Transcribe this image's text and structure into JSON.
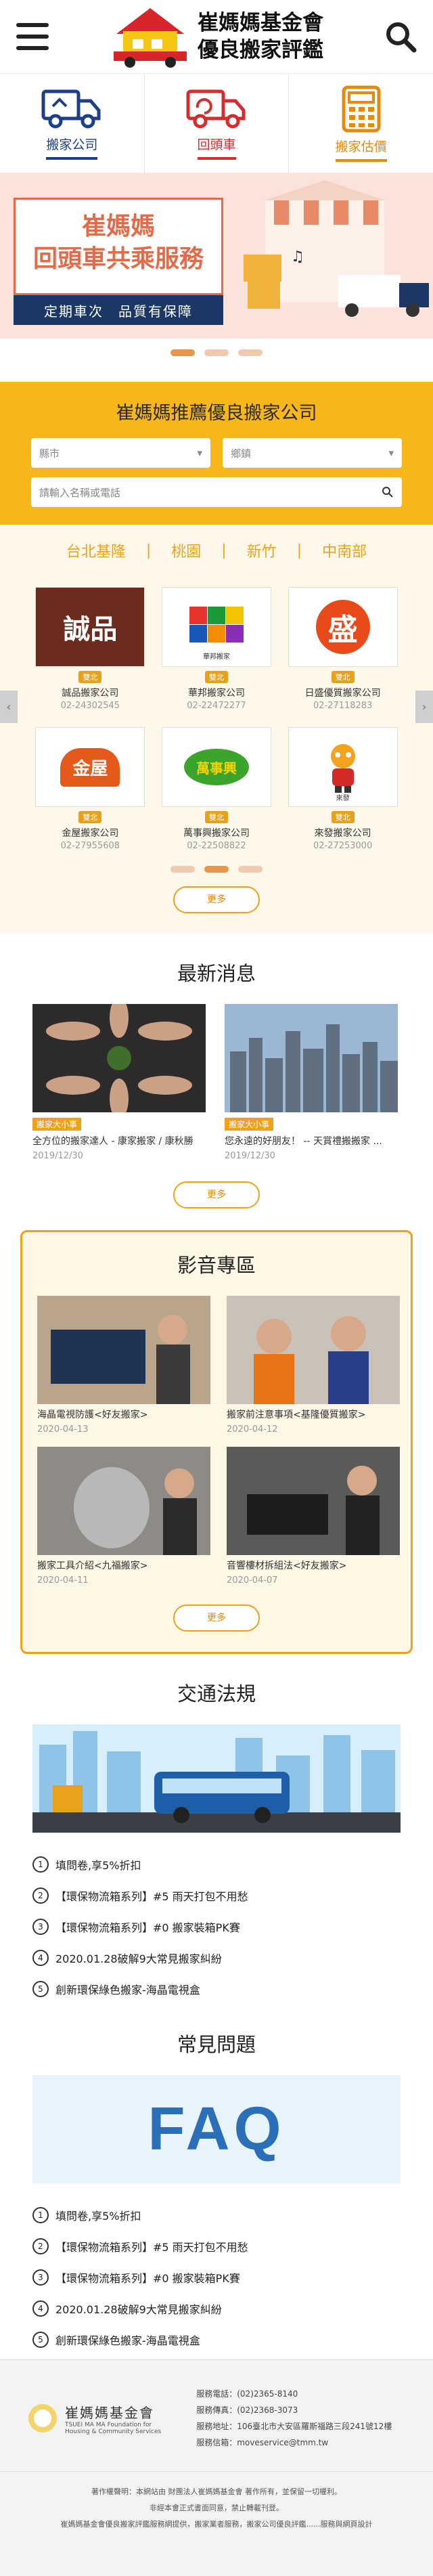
{
  "header": {
    "logo_line1": "崔媽媽基金會",
    "logo_line2": "優良搬家評鑑"
  },
  "services": [
    {
      "label": "搬家公司",
      "icon": "truck-icon"
    },
    {
      "label": "回頭車",
      "icon": "return-truck-icon"
    },
    {
      "label": "搬家估價",
      "icon": "calculator-icon"
    }
  ],
  "banner": {
    "line1": "崔媽媽",
    "line2": "回頭車共乘服務",
    "strip": "定期車次　品質有保障"
  },
  "recommend": {
    "title": "崔媽媽推薦優良搬家公司",
    "city_select": "縣市",
    "district_select": "鄉鎮",
    "search_placeholder": "請輸入名稱或電話",
    "tabs": [
      "台北基隆",
      "桃園",
      "新竹",
      "中南部"
    ],
    "companies": [
      {
        "badge": "雙北",
        "name": "誠品搬家公司",
        "tel": "02-24302545",
        "logo_text": "誠品"
      },
      {
        "badge": "雙北",
        "name": "華邦搬家公司",
        "tel": "02-22472277",
        "logo_text": "華邦搬家"
      },
      {
        "badge": "雙北",
        "name": "日盛優質搬家公司",
        "tel": "02-27118283",
        "logo_text": "盛"
      },
      {
        "badge": "雙北",
        "name": "金屋搬家公司",
        "tel": "02-27955608",
        "logo_text": "金屋"
      },
      {
        "badge": "雙北",
        "name": "萬事興搬家公司",
        "tel": "02-22508822",
        "logo_text": "萬事興"
      },
      {
        "badge": "雙北",
        "name": "來發搬家公司",
        "tel": "02-27253000",
        "logo_text": "來發"
      }
    ],
    "more": "更多"
  },
  "news": {
    "title": "最新消息",
    "items": [
      {
        "tag": "搬家大小事",
        "title": "全方位的搬家達人 - 康家搬家 / 康秋勝",
        "date": "2019/12/30"
      },
      {
        "tag": "搬家大小事",
        "title": "您永遠的好朋友！ -- 天賞禮搬搬家 ...",
        "date": "2019/12/30"
      }
    ],
    "more": "更多"
  },
  "video": {
    "title": "影音專區",
    "items": [
      {
        "title": "海晶電視防護<好友搬家>",
        "date": "2020-04-13"
      },
      {
        "title": "搬家前注意事項<基隆優質搬家>",
        "date": "2020-04-12"
      },
      {
        "title": "搬家工具介紹<九福搬家>",
        "date": "2020-04-11"
      },
      {
        "title": "音響樓材拆組法<好友搬家>",
        "date": "2020-04-07"
      }
    ],
    "more": "更多"
  },
  "traffic": {
    "title": "交通法規",
    "items": [
      "填問卷,享5%折扣",
      "【環保物流箱系列】#5 雨天打包不用愁",
      "【環保物流箱系列】#0 搬家裝箱PK賽",
      "2020.01.28破解9大常見搬家糾紛",
      "創新環保綠色搬家-海晶電視盒"
    ]
  },
  "faq": {
    "title": "常見問題",
    "hero_text": "FAQ",
    "items": [
      "填問卷,享5%折扣",
      "【環保物流箱系列】#5 雨天打包不用愁",
      "【環保物流箱系列】#0 搬家裝箱PK賽",
      "2020.01.28破解9大常見搬家糾紛",
      "創新環保綠色搬家-海晶電視盒"
    ]
  },
  "footer": {
    "org_cn": "崔媽媽基金會",
    "org_en_1": "TSUEI MA MA Foundation for",
    "org_en_2": "Housing & Community Services",
    "phone": "服務電話：(02)2365-8140",
    "fax": "服務傳真：(02)2368-3073",
    "address": "服務地址：106臺北市大安區羅斯福路三段241號12樓",
    "email": "服務信箱：moveservice@tmm.tw",
    "copy_1": "著作權聲明：本網站由 財團法人崔媽媽基金會 著作所有，並保留一切權利。",
    "copy_2": "非經本會正式書面同意，禁止轉載刊登。",
    "copy_3": "崔媽媽基金會優良搬家評鑑服務網提供，搬家業者服務，搬家公司優良評鑑......服務與網頁設計"
  },
  "colors": {
    "navy": "#1d3f87",
    "red": "#d12f2f",
    "orange": "#f0a11a",
    "yellow": "#f7b619"
  }
}
